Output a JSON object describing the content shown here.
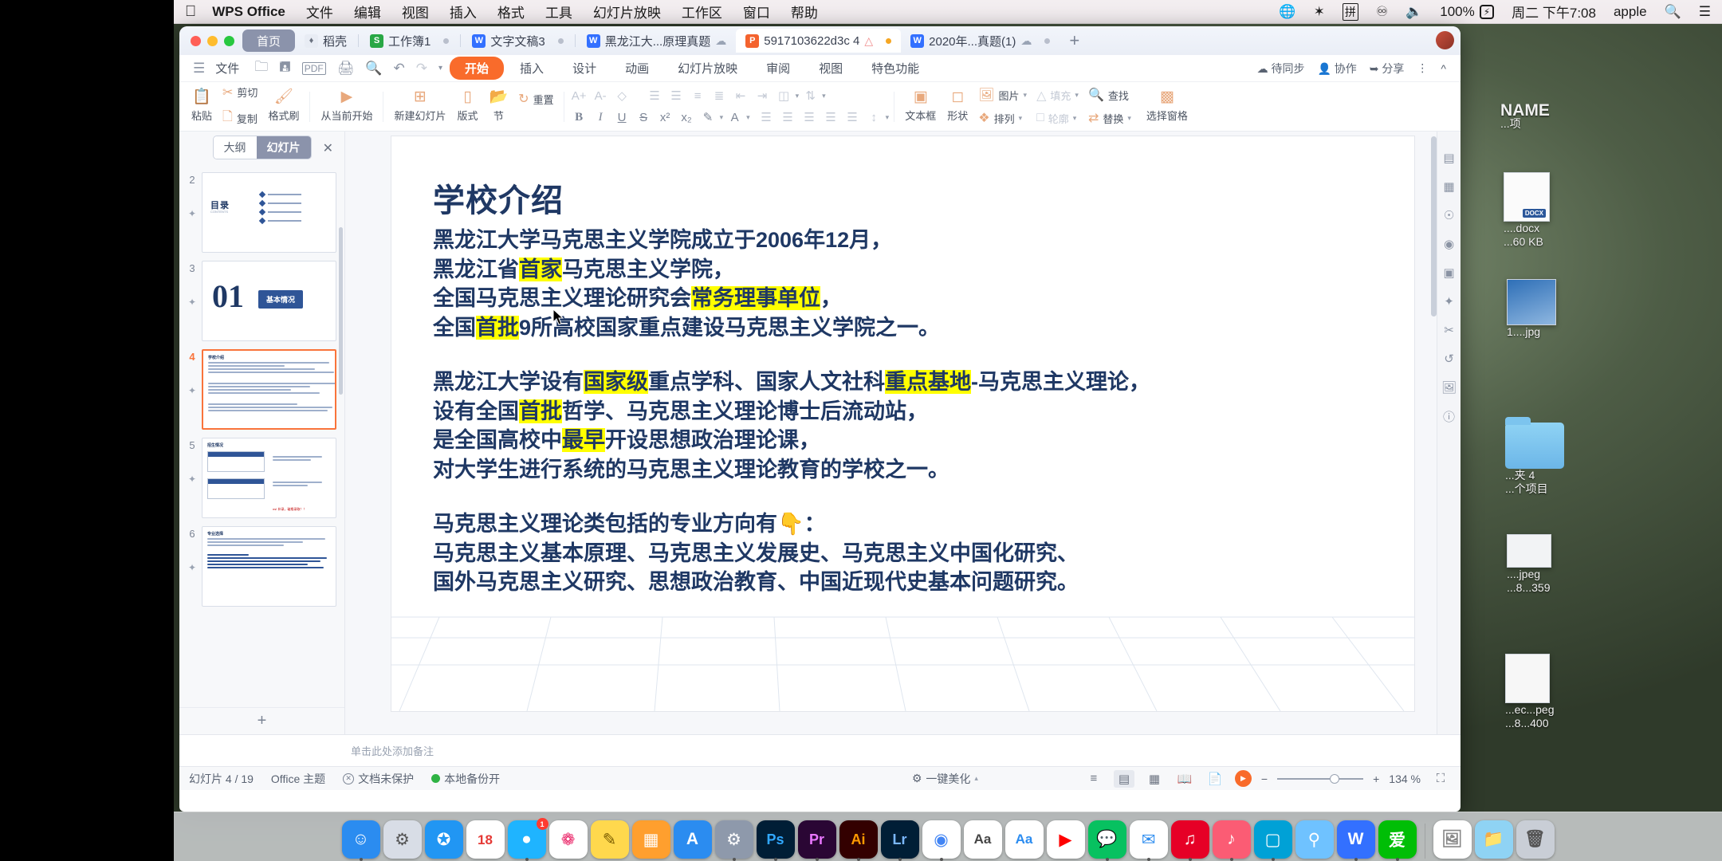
{
  "menubar": {
    "apple_icon": "apple-logo-icon",
    "app_name": "WPS Office",
    "items": [
      "文件",
      "编辑",
      "视图",
      "插入",
      "格式",
      "工具",
      "幻灯片放映",
      "工作区",
      "窗口",
      "帮助"
    ],
    "status_icons": [
      "globe-icon",
      "bluetooth-icon",
      "input-method-icon",
      "sogou-icon",
      "volume-icon"
    ],
    "battery_percent": "100%",
    "battery_icon": "battery-charging-icon",
    "datetime": "周二 下午7:08",
    "user": "apple",
    "search_icon": "search-icon",
    "control_center_icon": "control-center-icon"
  },
  "tabstrip": {
    "home_tab": "首页",
    "tabs": [
      {
        "label": "稻壳",
        "icon": "docer-icon",
        "kind": "docer",
        "modified": false,
        "cloud": false,
        "active": false
      },
      {
        "label": "工作簿1",
        "icon": "spreadsheet-icon",
        "kind": "s",
        "modified": true,
        "cloud": false,
        "active": false
      },
      {
        "label": "文字文稿3",
        "icon": "writer-icon",
        "kind": "w",
        "modified": true,
        "cloud": false,
        "active": false
      },
      {
        "label": "黑龙江大...原理真题",
        "icon": "writer-icon",
        "kind": "w",
        "modified": false,
        "cloud": true,
        "active": false
      },
      {
        "label": "5917103622d3c 4",
        "icon": "presentation-icon",
        "kind": "p",
        "modified": true,
        "cloud": false,
        "warn": true,
        "active": true
      },
      {
        "label": "2020年...真题(1)",
        "icon": "writer-icon",
        "kind": "w",
        "modified": true,
        "cloud": true,
        "active": false
      }
    ],
    "new_tab_icon": "plus-icon",
    "avatar": "user-avatar"
  },
  "ribbon": {
    "menu_icon": "hamburger-icon",
    "file_label": "文件",
    "quick_icons": [
      "open-folder-icon",
      "save-icon",
      "export-pdf-icon",
      "print-icon",
      "print-preview-icon",
      "undo-icon",
      "redo-icon",
      "more-caret-icon"
    ],
    "tabs": [
      "开始",
      "插入",
      "设计",
      "动画",
      "幻灯片放映",
      "审阅",
      "视图",
      "特色功能"
    ],
    "active_tab": "开始",
    "right": [
      {
        "label": "待同步",
        "icon": "cloud-sync-icon"
      },
      {
        "label": "协作",
        "icon": "collaborate-icon"
      },
      {
        "label": "分享",
        "icon": "share-icon"
      }
    ],
    "more_icon": "kebab-icon",
    "collapse_icon": "chevron-up-icon"
  },
  "toolbar": {
    "paste": {
      "label": "粘贴",
      "icon": "paste-icon",
      "has_caret": true
    },
    "cut": {
      "label": "剪切",
      "icon": "scissors-icon"
    },
    "copy": {
      "label": "复制",
      "icon": "copy-icon"
    },
    "format_painter": {
      "label": "格式刷",
      "icon": "format-painter-icon"
    },
    "start_from_current": {
      "label": "从当前开始",
      "icon": "play-circle-icon",
      "has_caret": true
    },
    "new_slide": {
      "label": "新建幻灯片",
      "icon": "new-slide-icon",
      "has_caret": true
    },
    "layout": {
      "label": "版式",
      "icon": "layout-icon",
      "has_caret": true
    },
    "section": {
      "label": "节",
      "icon": "section-icon",
      "has_caret": true
    },
    "reset": {
      "label": "重置",
      "icon": "reset-icon"
    },
    "font_grow": "A+",
    "font_shrink": "A-",
    "clear_format_icon": "clear-format-icon",
    "bold": "B",
    "italic": "I",
    "underline": "U",
    "strike": "S",
    "superscript": "x²",
    "subscript": "x₂",
    "text_highlight_icon": "highlight-icon",
    "font_color_icon": "font-color-icon",
    "align_left_icon": "align-left-icon",
    "align_center_icon": "align-center-icon",
    "align_right_icon": "align-right-icon",
    "align_justify_icon": "align-justify-icon",
    "align_distribute_icon": "align-distribute-icon",
    "line_spacing_icon": "line-spacing-icon",
    "columns_icon": "columns-icon",
    "bullets_icon": "bullets-icon",
    "numbering_icon": "numbering-icon",
    "indent_dec_icon": "decrease-indent-icon",
    "indent_inc_icon": "increase-indent-icon",
    "text_direction_icon": "text-direction-icon",
    "textbox": {
      "label": "文本框",
      "icon": "textbox-icon",
      "has_caret": true
    },
    "shape": {
      "label": "形状",
      "icon": "shape-icon",
      "has_caret": true
    },
    "picture": {
      "label": "图片",
      "icon": "picture-icon",
      "has_caret": true
    },
    "arrange": {
      "label": "排列",
      "icon": "arrange-icon",
      "has_caret": true
    },
    "fill": {
      "label": "填充",
      "icon": "fill-icon",
      "has_caret": true,
      "disabled": true
    },
    "outline": {
      "label": "轮廓",
      "icon": "outline-icon",
      "has_caret": true,
      "disabled": true
    },
    "find": {
      "label": "查找",
      "icon": "search-icon"
    },
    "replace": {
      "label": "替换",
      "icon": "replace-icon",
      "has_caret": true
    },
    "selection_pane": {
      "label": "选择窗格",
      "icon": "selection-pane-icon"
    }
  },
  "navpanel": {
    "tab_outline": "大纲",
    "tab_slides": "幻灯片",
    "active_tab": "幻灯片",
    "close_icon": "close-icon",
    "add_slide_icon": "plus-icon",
    "thumbs": [
      {
        "num": "2",
        "type": "toc",
        "title": "目录",
        "subtitle": "CONTENTS",
        "bullets": 4
      },
      {
        "num": "3",
        "type": "section",
        "number": "01",
        "chip": "基本情况"
      },
      {
        "num": "4",
        "type": "content",
        "title": "学校介绍",
        "selected": true
      },
      {
        "num": "5",
        "type": "table",
        "title": "招生情况"
      },
      {
        "num": "6",
        "type": "bullets",
        "title": "专业选择"
      }
    ]
  },
  "slide": {
    "title": "学校介绍",
    "para1": [
      [
        {
          "t": "黑龙江大学马克思主义学院成立于2006年12月，",
          "hl": false
        }
      ],
      [
        {
          "t": "黑龙江省",
          "hl": false
        },
        {
          "t": "首家",
          "hl": true
        },
        {
          "t": "马克思主义学院，",
          "hl": false
        }
      ],
      [
        {
          "t": "全国马克思主义理论研究会",
          "hl": false
        },
        {
          "t": "常务理事单位",
          "hl": true
        },
        {
          "t": "，",
          "hl": false
        }
      ],
      [
        {
          "t": "全国",
          "hl": false
        },
        {
          "t": "首批",
          "hl": true
        },
        {
          "t": "9所高校国家重点建设马克思主义学院之一。",
          "hl": false
        }
      ]
    ],
    "para2": [
      [
        {
          "t": "黑龙江大学设有",
          "hl": false
        },
        {
          "t": "国家级",
          "hl": true
        },
        {
          "t": "重点学科、国家人文社科",
          "hl": false
        },
        {
          "t": "重点基地",
          "hl": true
        },
        {
          "t": "-马克思主义理论，",
          "hl": false
        }
      ],
      [
        {
          "t": "设有全国",
          "hl": false
        },
        {
          "t": "首批",
          "hl": true
        },
        {
          "t": "哲学、马克思主义理论博士后流动站，",
          "hl": false
        }
      ],
      [
        {
          "t": "是全国高校中",
          "hl": false
        },
        {
          "t": "最早",
          "hl": true
        },
        {
          "t": "开设思想政治理论课，",
          "hl": false
        }
      ],
      [
        {
          "t": "对大学生进行系统的马克思主义理论教育的学校之一。",
          "hl": false
        }
      ]
    ],
    "para3": [
      [
        {
          "t": "马克思主义理论类包括的专业方向有👇：",
          "hl": false
        }
      ],
      [
        {
          "t": "马克思主义基本原理、马克思主义发展史、马克思主义中国化研究、",
          "hl": false
        }
      ],
      [
        {
          "t": "国外马克思主义研究、思想政治教育、中国近现代史基本问题研究。",
          "hl": false
        }
      ]
    ],
    "accent_color": "#1f3864",
    "highlight_color": "#ffff00"
  },
  "rail": {
    "icons": [
      "properties-icon",
      "layers-icon",
      "design-idea-icon",
      "target-icon",
      "crop-icon",
      "ai-sparkle-icon",
      "cut-tool-icon",
      "history-icon",
      "image-tool-icon",
      "help-icon"
    ]
  },
  "notes": {
    "placeholder": "单击此处添加备注"
  },
  "statusbar": {
    "slide_count": "幻灯片 4 / 19",
    "theme": "Office 主题",
    "protection": "文档未保护",
    "protection_icon": "shield-x-icon",
    "backup": "本地备份开",
    "backup_icon": "status-green-dot",
    "beautify": "一键美化",
    "beautify_icon": "magic-wand-icon",
    "view_icons": [
      "outline-view-icon",
      "normal-view-icon",
      "slide-sorter-icon",
      "reading-view-icon",
      "notes-view-icon"
    ],
    "active_view": "normal-view-icon",
    "play_icon": "play-icon",
    "zoom_minus": "−",
    "zoom_plus": "+",
    "zoom_value": "134 %",
    "fit_icon": "fit-to-window-icon"
  },
  "desktop_icons": [
    {
      "label": "NAME",
      "sub": "...项",
      "kind": "text"
    },
    {
      "label": "....docx",
      "sub": "...60 KB",
      "kind": "doc"
    },
    {
      "label": "1....jpg",
      "kind": "image"
    },
    {
      "label": "...夹 4",
      "sub": "...个项目",
      "kind": "folder"
    },
    {
      "label": "....jpeg",
      "sub": "...8...359",
      "kind": "image"
    },
    {
      "label": "...ec...peg",
      "sub": "...8...400",
      "kind": "image"
    }
  ],
  "dock": {
    "items": [
      {
        "name": "finder-icon",
        "glyph": "🙂",
        "color": "#2b8cf0",
        "running": true
      },
      {
        "name": "launchpad-icon",
        "glyph": "🚀",
        "color": "#d8dde6",
        "running": false
      },
      {
        "name": "safari-icon",
        "glyph": "🧭",
        "color": "#2196f3",
        "running": false
      },
      {
        "name": "calendar-icon",
        "glyph": "18",
        "color": "#ffffff",
        "running": false
      },
      {
        "name": "qq-icon",
        "glyph": "🐧",
        "color": "#1fb4ff",
        "running": true,
        "badge": "1"
      },
      {
        "name": "photos-icon",
        "glyph": "🌸",
        "color": "#ffffff",
        "running": false
      },
      {
        "name": "notes-icon",
        "glyph": "📝",
        "color": "#ffd84d",
        "running": false
      },
      {
        "name": "charts-icon",
        "glyph": "📊",
        "color": "#ff9f2e",
        "running": false
      },
      {
        "name": "appstore-icon",
        "glyph": "A",
        "color": "#2b8cf0",
        "running": false
      },
      {
        "name": "settings-icon",
        "glyph": "⚙",
        "color": "#8e99ab",
        "running": true
      },
      {
        "name": "photoshop-icon",
        "glyph": "Ps",
        "color": "#001e36",
        "running": true
      },
      {
        "name": "premiere-icon",
        "glyph": "Pr",
        "color": "#2a0634",
        "running": true
      },
      {
        "name": "illustrator-icon",
        "glyph": "Ai",
        "color": "#330000",
        "running": true
      },
      {
        "name": "lightroom-icon",
        "glyph": "Lr",
        "color": "#001e36",
        "running": true
      },
      {
        "name": "chrome-icon",
        "glyph": "◎",
        "color": "#ffffff",
        "running": true
      },
      {
        "name": "dictionary-icon",
        "glyph": "Aa",
        "color": "#ffffff",
        "running": false
      },
      {
        "name": "translate-icon",
        "glyph": "译",
        "color": "#ffffff",
        "running": false
      },
      {
        "name": "youtube-icon",
        "glyph": "▶",
        "color": "#ffffff",
        "running": false
      },
      {
        "name": "wechat-icon",
        "glyph": "💬",
        "color": "#07c160",
        "running": true
      },
      {
        "name": "mail-icon",
        "glyph": "✉",
        "color": "#ffffff",
        "running": true
      },
      {
        "name": "netease-music-icon",
        "glyph": "♫",
        "color": "#e60026",
        "running": true
      },
      {
        "name": "itunes-icon",
        "glyph": "♪",
        "color": "#fb5c74",
        "running": true
      },
      {
        "name": "bilibili-icon",
        "glyph": "📺",
        "color": "#00a1d6",
        "running": true
      },
      {
        "name": "maps-icon",
        "glyph": "🗺",
        "color": "#6fc2ff",
        "running": false
      },
      {
        "name": "wps-writer-icon",
        "glyph": "W",
        "color": "#3370ff",
        "running": true
      },
      {
        "name": "iqiyi-icon",
        "glyph": "爱",
        "color": "#00be06",
        "running": true
      },
      {
        "name": "screenshot-icon",
        "glyph": "🖼",
        "color": "#ffffff",
        "running": false
      },
      {
        "name": "downloads-icon",
        "glyph": "📁",
        "color": "#8fd3f4",
        "running": false
      },
      {
        "name": "trash-icon",
        "glyph": "🗑",
        "color": "#c9ced6",
        "running": false
      }
    ]
  }
}
